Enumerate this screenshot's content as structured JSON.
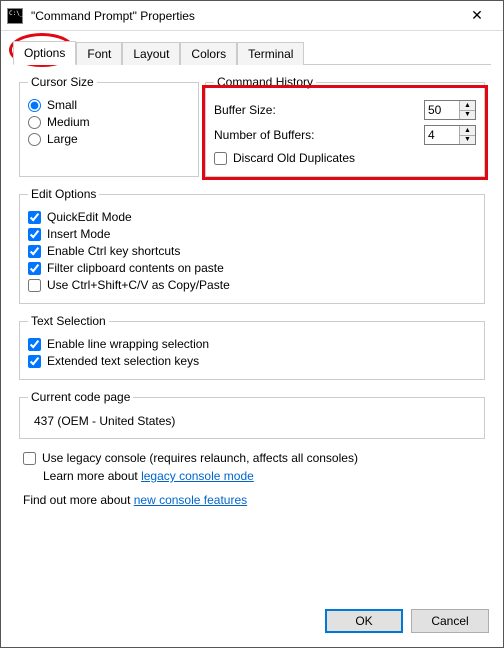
{
  "window": {
    "title": "\"Command Prompt\" Properties",
    "close_glyph": "✕"
  },
  "tabs": {
    "options": "Options",
    "font": "Font",
    "layout": "Layout",
    "colors": "Colors",
    "terminal": "Terminal"
  },
  "cursor": {
    "legend": "Cursor Size",
    "small": "Small",
    "medium": "Medium",
    "large": "Large"
  },
  "history": {
    "legend": "Command History",
    "buffer_size_label": "Buffer Size:",
    "buffer_size_value": "50",
    "num_buffers_label": "Number of Buffers:",
    "num_buffers_value": "4",
    "discard_label": "Discard Old Duplicates"
  },
  "edit": {
    "legend": "Edit Options",
    "quickedit": "QuickEdit Mode",
    "insert": "Insert Mode",
    "ctrl_shortcuts": "Enable Ctrl key shortcuts",
    "filter_clip": "Filter clipboard contents on paste",
    "use_ctrlshift": "Use Ctrl+Shift+C/V as Copy/Paste"
  },
  "textsel": {
    "legend": "Text Selection",
    "linewrap": "Enable line wrapping selection",
    "extended": "Extended text selection keys"
  },
  "codepage": {
    "legend": "Current code page",
    "value": "437   (OEM - United States)"
  },
  "legacy": {
    "checkbox_label": "Use legacy console (requires relaunch, affects all consoles)",
    "learn_prefix": "Learn more about ",
    "learn_link": "legacy console mode"
  },
  "features": {
    "prefix": "Find out more about ",
    "link": "new console features"
  },
  "buttons": {
    "ok": "OK",
    "cancel": "Cancel"
  }
}
